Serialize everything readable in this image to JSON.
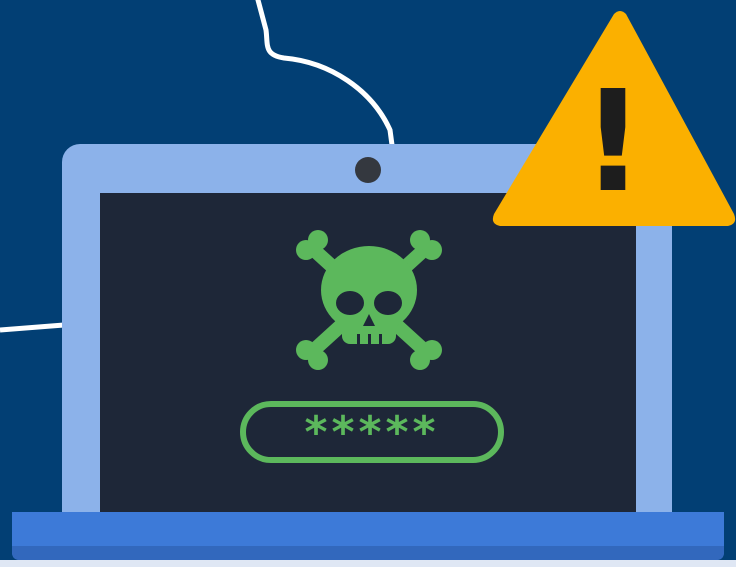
{
  "illustration": {
    "password_mask": "*****",
    "warning_glyph": "!",
    "icons": {
      "skull": "skull-crossbones-icon",
      "warning": "warning-triangle-icon",
      "camera": "webcam-icon",
      "cloud": "cloud-outline-icon"
    },
    "colors": {
      "background": "#023f74",
      "laptop_bezel": "#8cb2ea",
      "laptop_base": "#3d7ad8",
      "screen": "#1e2738",
      "malware_green": "#5cb85c",
      "warning_yellow": "#fbb000",
      "glyph_dark": "#1d1d1d",
      "cloud_line": "#ffffff"
    }
  }
}
